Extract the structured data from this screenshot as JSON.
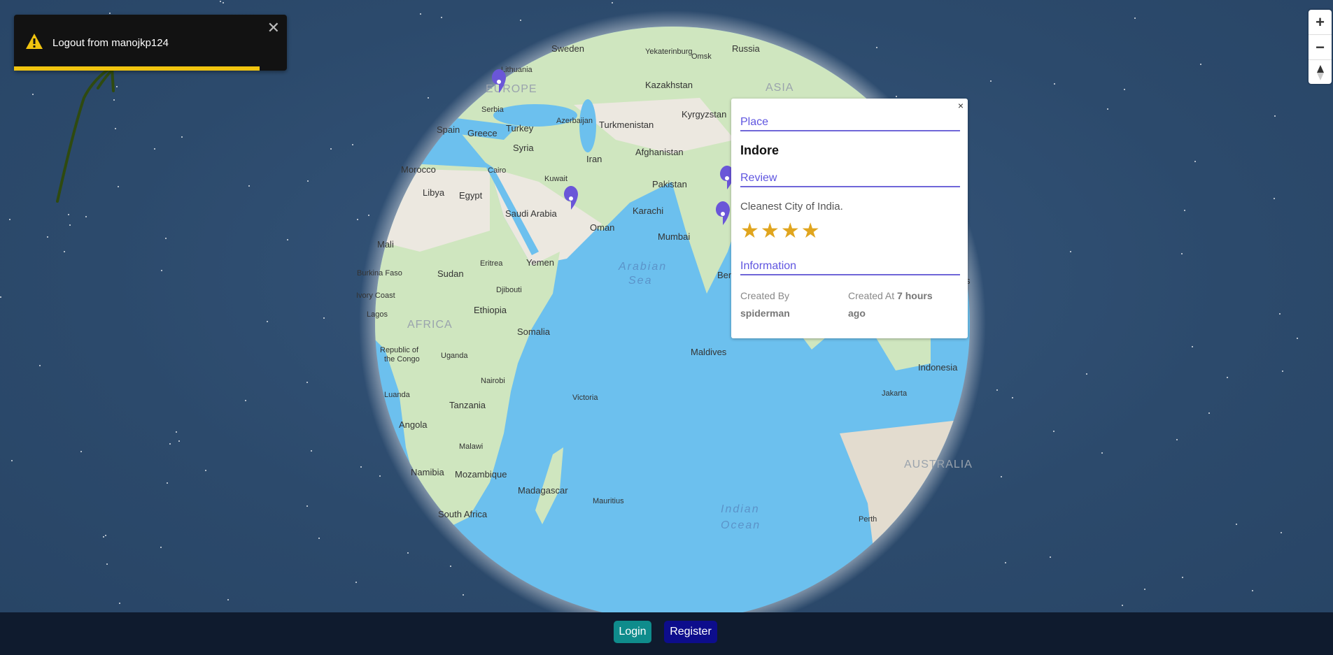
{
  "toast": {
    "message": "Logout from manojkp124",
    "close_label": "✕",
    "progress": 0.9
  },
  "zoom": {
    "zoom_in": "+",
    "zoom_out": "−",
    "compass": "▲"
  },
  "map": {
    "regions": [
      "EUROPE",
      "ASIA",
      "AFRICA",
      "AUSTRALIA"
    ],
    "seas": [
      "Arabian",
      "Sea",
      "Indian",
      "Ocean"
    ],
    "labels": [
      "Sweden",
      "Russia",
      "Yekaterinburg",
      "Omsk",
      "Lithuania",
      "Kazakhstan",
      "Serbia",
      "Spain",
      "Greece",
      "Turkey",
      "Azerbaijan",
      "Turkmenistan",
      "Kyrgyzstan",
      "Syria",
      "Iran",
      "Afghanistan",
      "Morocco",
      "Cairo",
      "Kuwait",
      "Pakistan",
      "Libya",
      "Egypt",
      "Saudi Arabia",
      "Karachi",
      "Oman",
      "Mumbai",
      "Mali",
      "Sudan",
      "Eritrea",
      "Yemen",
      "Burkina Faso",
      "Djibouti",
      "Ivory Coast",
      "Ethiopia",
      "Lagos",
      "Somalia",
      "Republic of",
      "the Congo",
      "Uganda",
      "Maldives",
      "Nairobi",
      "Indonesia",
      "Luanda",
      "Tanzania",
      "Victoria",
      "Jakarta",
      "Angola",
      "Malawi",
      "Namibia",
      "Mozambique",
      "Madagascar",
      "Mauritius",
      "South Africa",
      "Perth",
      "Ben",
      "s"
    ]
  },
  "popup": {
    "close_label": "×",
    "place_label": "Place",
    "place_name": "Indore",
    "review_label": "Review",
    "review_text": "Cleanest City of India.",
    "rating": 4,
    "info_label": "Information",
    "created_by_label": "Created By",
    "created_by": "spiderman",
    "created_at_label": "Created At",
    "created_at_line1": "7 hours",
    "created_at_line2": "ago"
  },
  "footer": {
    "login_label": "Login",
    "register_label": "Register"
  },
  "colors": {
    "toast_progress": "#f1c40f",
    "accent": "#5f55e0",
    "login": "#0f8c8c",
    "register": "#0d0d8c",
    "star": "#e0a51e",
    "pin": "#6a56d8"
  }
}
